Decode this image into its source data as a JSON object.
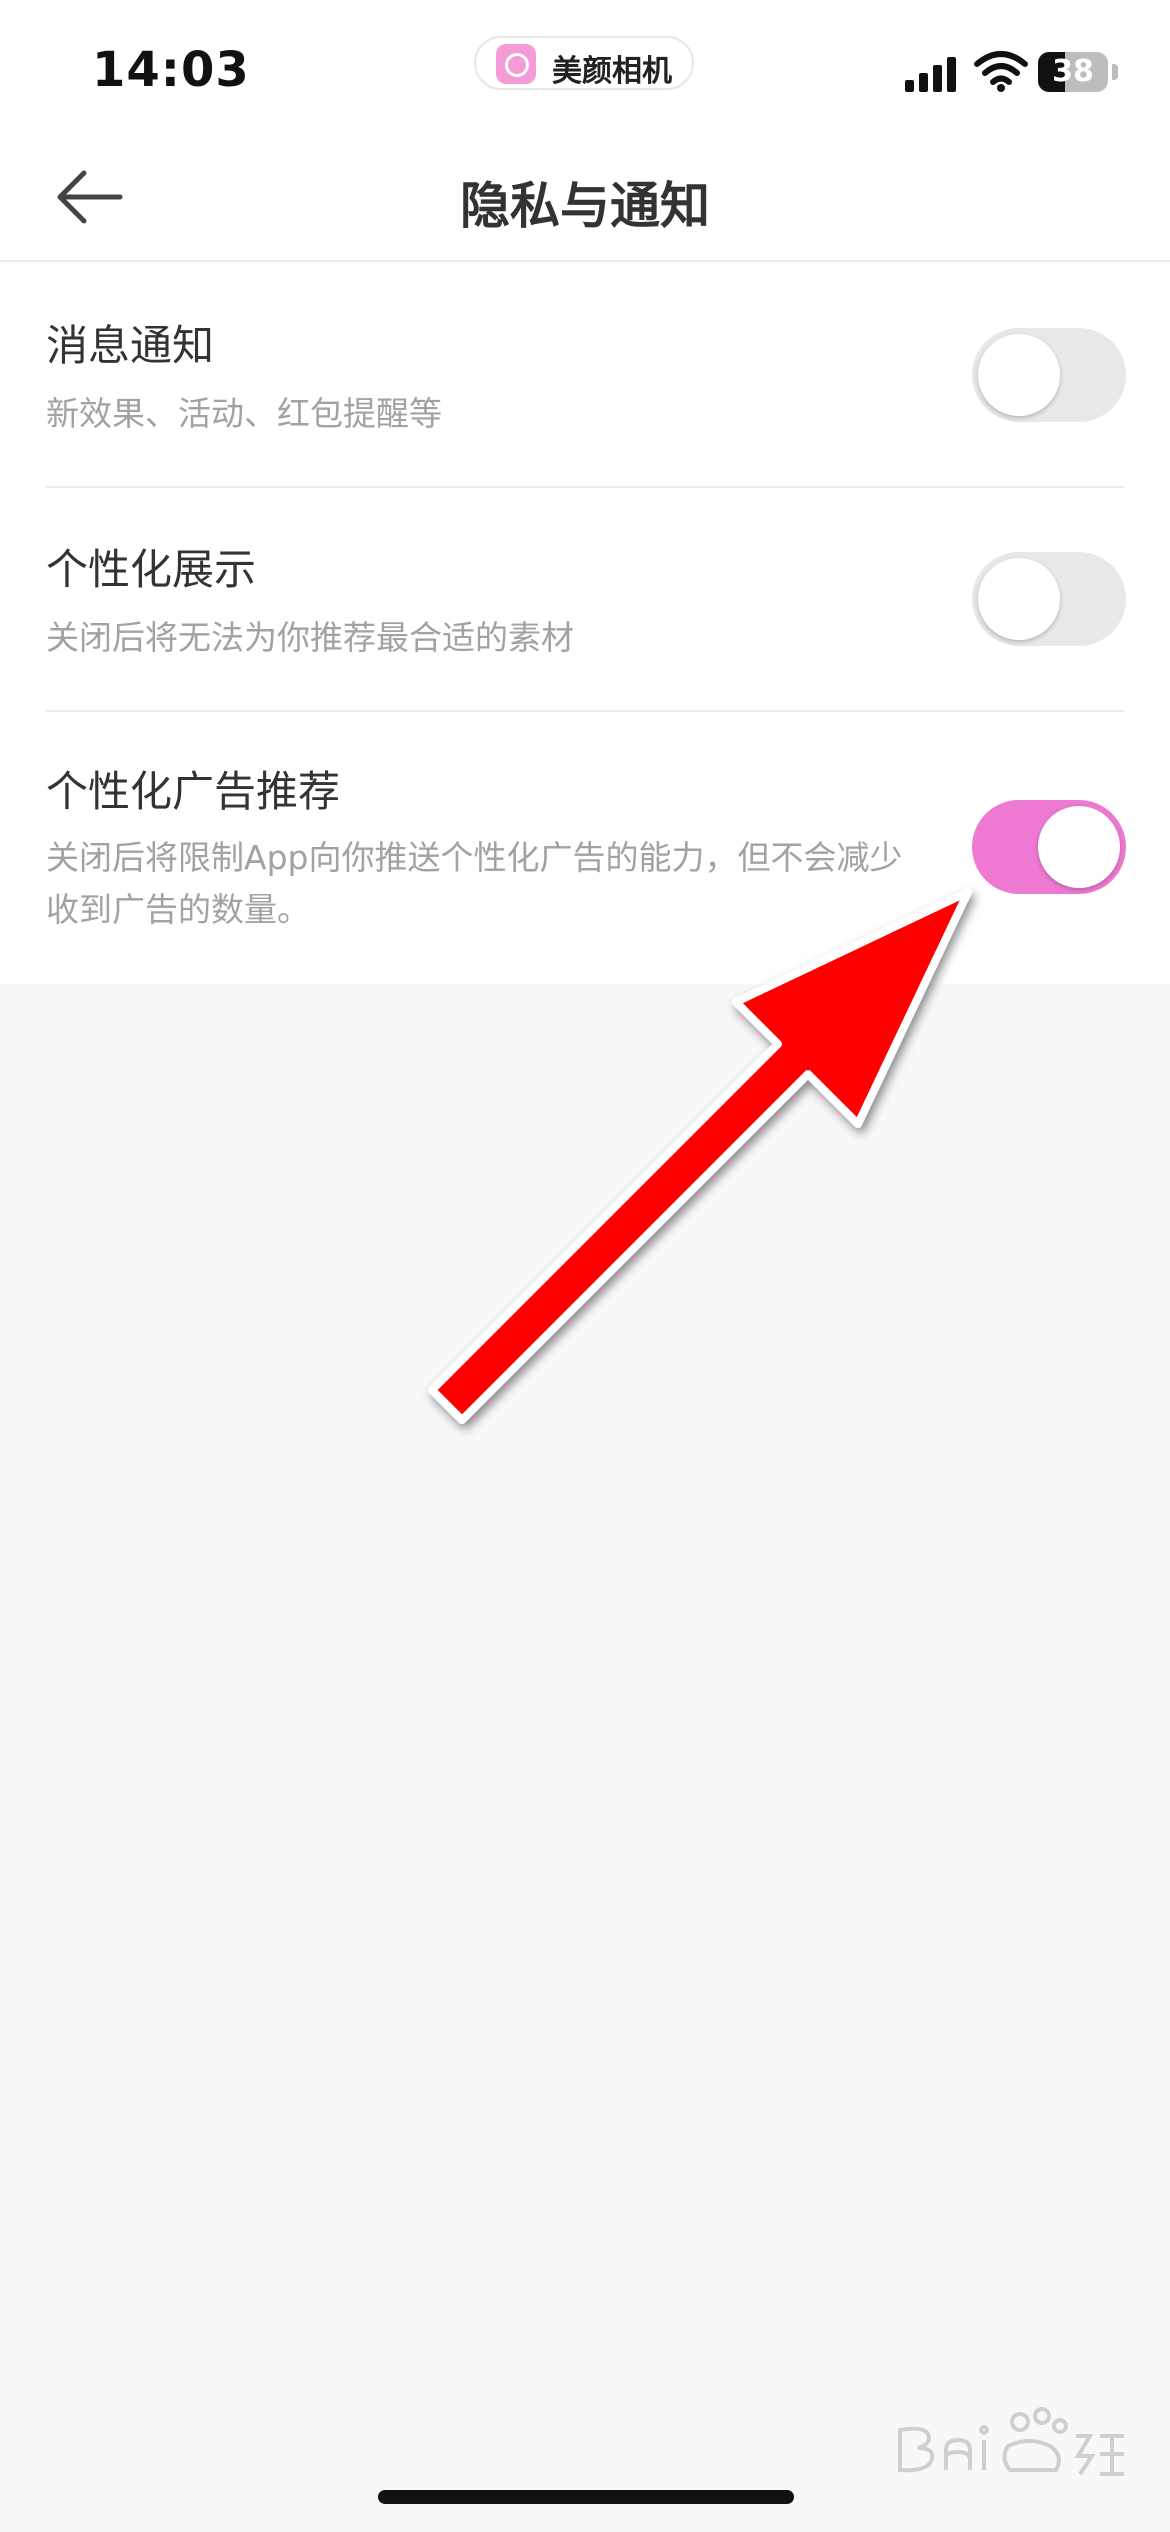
{
  "status_bar": {
    "time": "14:03",
    "app_name": "美颜相机",
    "battery": "38",
    "battery_level": 0.38,
    "icons": [
      "signal-icon",
      "wifi-icon",
      "battery-icon"
    ]
  },
  "nav": {
    "back_icon": "back-arrow-icon",
    "title": "隐私与通知"
  },
  "settings": [
    {
      "title": "消息通知",
      "desc": "新效果、活动、红包提醒等",
      "enabled": false
    },
    {
      "title": "个性化展示",
      "desc": "关闭后将无法为你推荐最合适的素材",
      "enabled": false
    },
    {
      "title": "个性化广告推荐",
      "desc": "关闭后将限制App向你推送个性化广告的能力，但不会减少收到广告的数量。",
      "enabled": true
    }
  ],
  "colors": {
    "toggle_on": "#ee79d2",
    "toggle_off": "#e8e8e8",
    "annotation_arrow": "#ff0000"
  },
  "annotation": {
    "icon": "red-arrow-icon"
  },
  "watermark": {
    "logo": "baidu-jingyan-logo"
  }
}
